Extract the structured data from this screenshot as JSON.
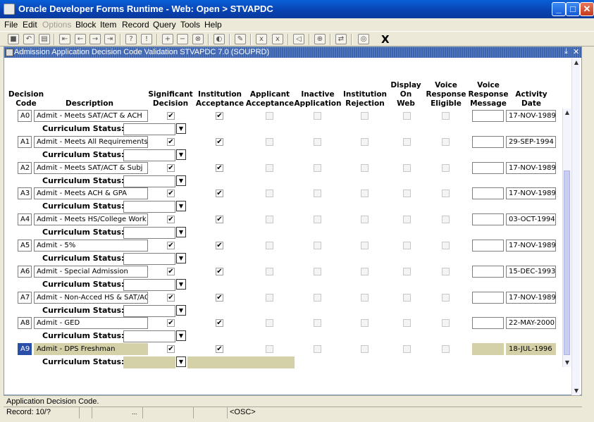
{
  "window": {
    "title": "Oracle Developer Forms Runtime - Web:  Open > STVAPDC",
    "minimize_label": "_",
    "maximize_label": "□",
    "close_label": "✕"
  },
  "menu": {
    "file": "File",
    "edit": "Edit",
    "options": "Options",
    "block": "Block",
    "item": "Item",
    "record": "Record",
    "query": "Query",
    "tools": "Tools",
    "help": "Help"
  },
  "toolbar": {
    "icons": [
      "save-icon",
      "rollback-icon",
      "print-icon",
      "prev-block-icon",
      "prev-record-icon",
      "next-record-icon",
      "next-block-icon",
      "enter-query-icon",
      "execute-query-icon",
      "insert-record-icon",
      "remove-record-icon",
      "lock-record-icon",
      "clear-form-icon",
      "edit-field-icon",
      "print-record-icon",
      "list-values-icon",
      "help-icon",
      "exit-icon",
      "block-help-icon",
      "options-icon",
      "search-icon"
    ],
    "exit_label": "X"
  },
  "form": {
    "title": "Admission Application Decision Code Validation  STVAPDC  7.0  (SOUPRD)",
    "title_buttons": [
      "⤓",
      "✕"
    ]
  },
  "headers": {
    "decision_code": [
      "Decision",
      "Code"
    ],
    "description": [
      "Description"
    ],
    "significant_decision": [
      "Significant",
      "Decision"
    ],
    "institution_acceptance": [
      "Institution",
      "Acceptance"
    ],
    "applicant_acceptance": [
      "Applicant",
      "Acceptance"
    ],
    "inactive_application": [
      "Inactive",
      "Application"
    ],
    "institution_rejection": [
      "Institution",
      "Rejection"
    ],
    "display_on_web": [
      "Display",
      "On",
      "Web"
    ],
    "voice_response_eligible": [
      "Voice",
      "Response",
      "Eligible"
    ],
    "voice_response_message": [
      "Voice",
      "Response",
      "Message"
    ],
    "activity_date": [
      "Activity",
      "Date"
    ]
  },
  "curriculum_status_label": "Curriculum Status:",
  "check_mark": "✔",
  "dropdown_glyph": "▼",
  "rows": [
    {
      "code": "A0",
      "description": "Admit - Meets SAT/ACT & ACH",
      "significant": true,
      "inst_accept": true,
      "appl_accept": false,
      "inactive": false,
      "inst_reject": false,
      "web": false,
      "voice_eligible": false,
      "voice_message": "",
      "activity_date": "17-NOV-1989",
      "curriculum_status": ""
    },
    {
      "code": "A1",
      "description": "Admit - Meets All Requirements",
      "significant": true,
      "inst_accept": true,
      "appl_accept": false,
      "inactive": false,
      "inst_reject": false,
      "web": false,
      "voice_eligible": false,
      "voice_message": "",
      "activity_date": "29-SEP-1994",
      "curriculum_status": ""
    },
    {
      "code": "A2",
      "description": "Admit - Meets SAT/ACT & Subj",
      "significant": true,
      "inst_accept": true,
      "appl_accept": false,
      "inactive": false,
      "inst_reject": false,
      "web": false,
      "voice_eligible": false,
      "voice_message": "",
      "activity_date": "17-NOV-1989",
      "curriculum_status": ""
    },
    {
      "code": "A3",
      "description": "Admit - Meets ACH & GPA",
      "significant": true,
      "inst_accept": true,
      "appl_accept": false,
      "inactive": false,
      "inst_reject": false,
      "web": false,
      "voice_eligible": false,
      "voice_message": "",
      "activity_date": "17-NOV-1989",
      "curriculum_status": ""
    },
    {
      "code": "A4",
      "description": "Admit - Meets HS/College Work",
      "significant": true,
      "inst_accept": true,
      "appl_accept": false,
      "inactive": false,
      "inst_reject": false,
      "web": false,
      "voice_eligible": false,
      "voice_message": "",
      "activity_date": "03-OCT-1994",
      "curriculum_status": ""
    },
    {
      "code": "A5",
      "description": "Admit - 5%",
      "significant": true,
      "inst_accept": true,
      "appl_accept": false,
      "inactive": false,
      "inst_reject": false,
      "web": false,
      "voice_eligible": false,
      "voice_message": "",
      "activity_date": "17-NOV-1989",
      "curriculum_status": ""
    },
    {
      "code": "A6",
      "description": "Admit - Special Admission",
      "significant": true,
      "inst_accept": true,
      "appl_accept": false,
      "inactive": false,
      "inst_reject": false,
      "web": false,
      "voice_eligible": false,
      "voice_message": "",
      "activity_date": "15-DEC-1993",
      "curriculum_status": ""
    },
    {
      "code": "A7",
      "description": "Admit - Non-Acced HS & SAT/ACT",
      "significant": true,
      "inst_accept": true,
      "appl_accept": false,
      "inactive": false,
      "inst_reject": false,
      "web": false,
      "voice_eligible": false,
      "voice_message": "",
      "activity_date": "17-NOV-1989",
      "curriculum_status": ""
    },
    {
      "code": "A8",
      "description": "Admit - GED",
      "significant": true,
      "inst_accept": true,
      "appl_accept": false,
      "inactive": false,
      "inst_reject": false,
      "web": false,
      "voice_eligible": false,
      "voice_message": "",
      "activity_date": "22-MAY-2000",
      "curriculum_status": ""
    },
    {
      "code": "A9",
      "description": "Admit - DPS Freshman",
      "significant": true,
      "inst_accept": true,
      "appl_accept": false,
      "inactive": false,
      "inst_reject": false,
      "web": false,
      "voice_eligible": false,
      "voice_message": "",
      "activity_date": "18-JUL-1996",
      "curriculum_status": ""
    }
  ],
  "current_row_index": 9,
  "status": {
    "hint": "Application Decision Code.",
    "record": "Record: 10/?",
    "ellipsis": "...",
    "osc": "<OSC>"
  },
  "colors": {
    "titlebar": "#0842b0",
    "current_record": "#d4d0a8",
    "current_code": "#2a4fa8"
  }
}
